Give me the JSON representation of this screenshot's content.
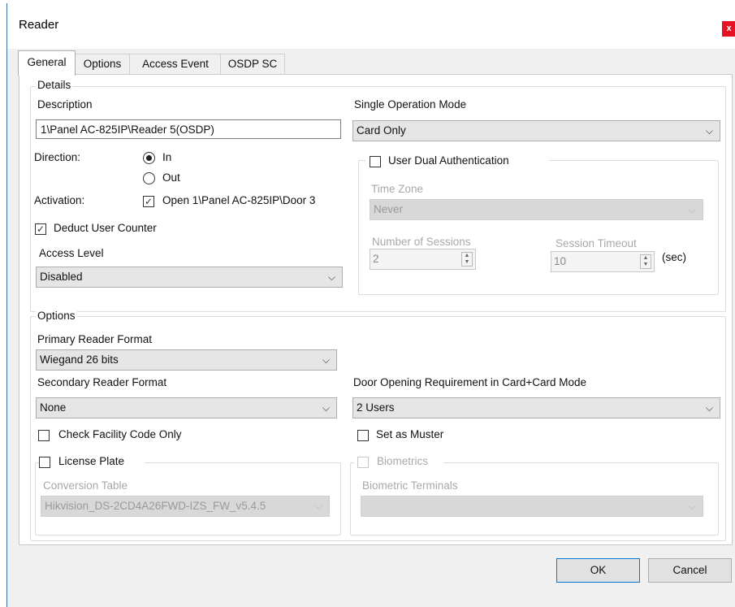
{
  "window": {
    "title": "Reader",
    "close_glyph": "x"
  },
  "tabs": [
    "General",
    "Options",
    "Access Event",
    "OSDP SC"
  ],
  "details": {
    "group_label": "Details",
    "description_label": "Description",
    "description_value": "1\\Panel AC-825IP\\Reader 5(OSDP)",
    "direction_label": "Direction:",
    "direction_in": "In",
    "direction_out": "Out",
    "activation_label": "Activation:",
    "activation_value": "Open 1\\Panel AC-825IP\\Door 3",
    "deduct_label": "Deduct User Counter",
    "access_level_label": "Access Level",
    "access_level_value": "Disabled",
    "single_op_label": "Single Operation Mode",
    "single_op_value": "Card Only",
    "dual_auth_label": "User Dual Authentication",
    "time_zone_label": "Time Zone",
    "time_zone_value": "Never",
    "sessions_label": "Number of Sessions",
    "sessions_value": "2",
    "timeout_label": "Session Timeout",
    "timeout_value": "10",
    "timeout_unit": "(sec)"
  },
  "options": {
    "group_label": "Options",
    "primary_label": "Primary Reader Format",
    "primary_value": "Wiegand 26 bits",
    "secondary_label": "Secondary Reader Format",
    "secondary_value": "None",
    "door_req_label": "Door Opening Requirement in Card+Card Mode",
    "door_req_value": "2 Users",
    "facility_label": "Check Facility Code Only",
    "muster_label": "Set as Muster",
    "plate_label": "License Plate",
    "conversion_label": "Conversion Table",
    "conversion_value": "Hikvision_DS-2CD4A26FWD-IZS_FW_v5.4.5",
    "biometrics_label": "Biometrics",
    "biometric_terminals_label": "Biometric Terminals",
    "biometric_terminals_value": ""
  },
  "buttons": {
    "ok": "OK",
    "cancel": "Cancel"
  },
  "glyphs": {
    "check": "✓",
    "chevron": "⌵",
    "spin_up": "▲",
    "spin_down": "▼"
  },
  "icons": {
    "close": "close-icon",
    "chevron": "chevron-down-icon"
  }
}
